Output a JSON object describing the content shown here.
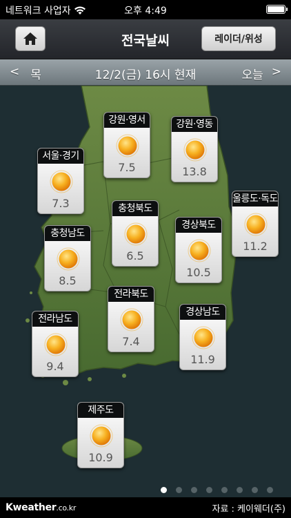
{
  "status": {
    "carrier": "네트워크 사업자",
    "time": "오후 4:49"
  },
  "nav": {
    "title": "전국날씨",
    "radar_label": "레이더/위성"
  },
  "date_bar": {
    "prev_arrow": "<",
    "prev_label": "목",
    "date_label": "12/2(금) 16시 현재",
    "next_label": "오늘",
    "next_arrow": ">"
  },
  "regions": [
    {
      "name": "강원·영서",
      "temp": "7.5",
      "icon": "sun-icon"
    },
    {
      "name": "강원·영동",
      "temp": "13.8",
      "icon": "sun-icon"
    },
    {
      "name": "서울·경기",
      "temp": "7.3",
      "icon": "sun-icon"
    },
    {
      "name": "충청북도",
      "temp": "6.5",
      "icon": "sun-icon"
    },
    {
      "name": "울릉도·독도",
      "temp": "11.2",
      "icon": "sun-icon"
    },
    {
      "name": "충청남도",
      "temp": "8.5",
      "icon": "sun-icon"
    },
    {
      "name": "경상북도",
      "temp": "10.5",
      "icon": "sun-icon"
    },
    {
      "name": "전라북도",
      "temp": "7.4",
      "icon": "sun-icon"
    },
    {
      "name": "경상남도",
      "temp": "11.9",
      "icon": "sun-icon"
    },
    {
      "name": "전라남도",
      "temp": "9.4",
      "icon": "sun-icon"
    },
    {
      "name": "제주도",
      "temp": "10.9",
      "icon": "sun-icon"
    }
  ],
  "pagination": {
    "total": 8,
    "active": 1
  },
  "footer": {
    "brand_main": "Kweather",
    "brand_domain": ".co.kr",
    "source": "자료 : 케이웨더(주)"
  },
  "colors": {
    "sun": "#f5a312",
    "map_land": "#5a7a3a",
    "map_sea": "#1e2e33"
  }
}
